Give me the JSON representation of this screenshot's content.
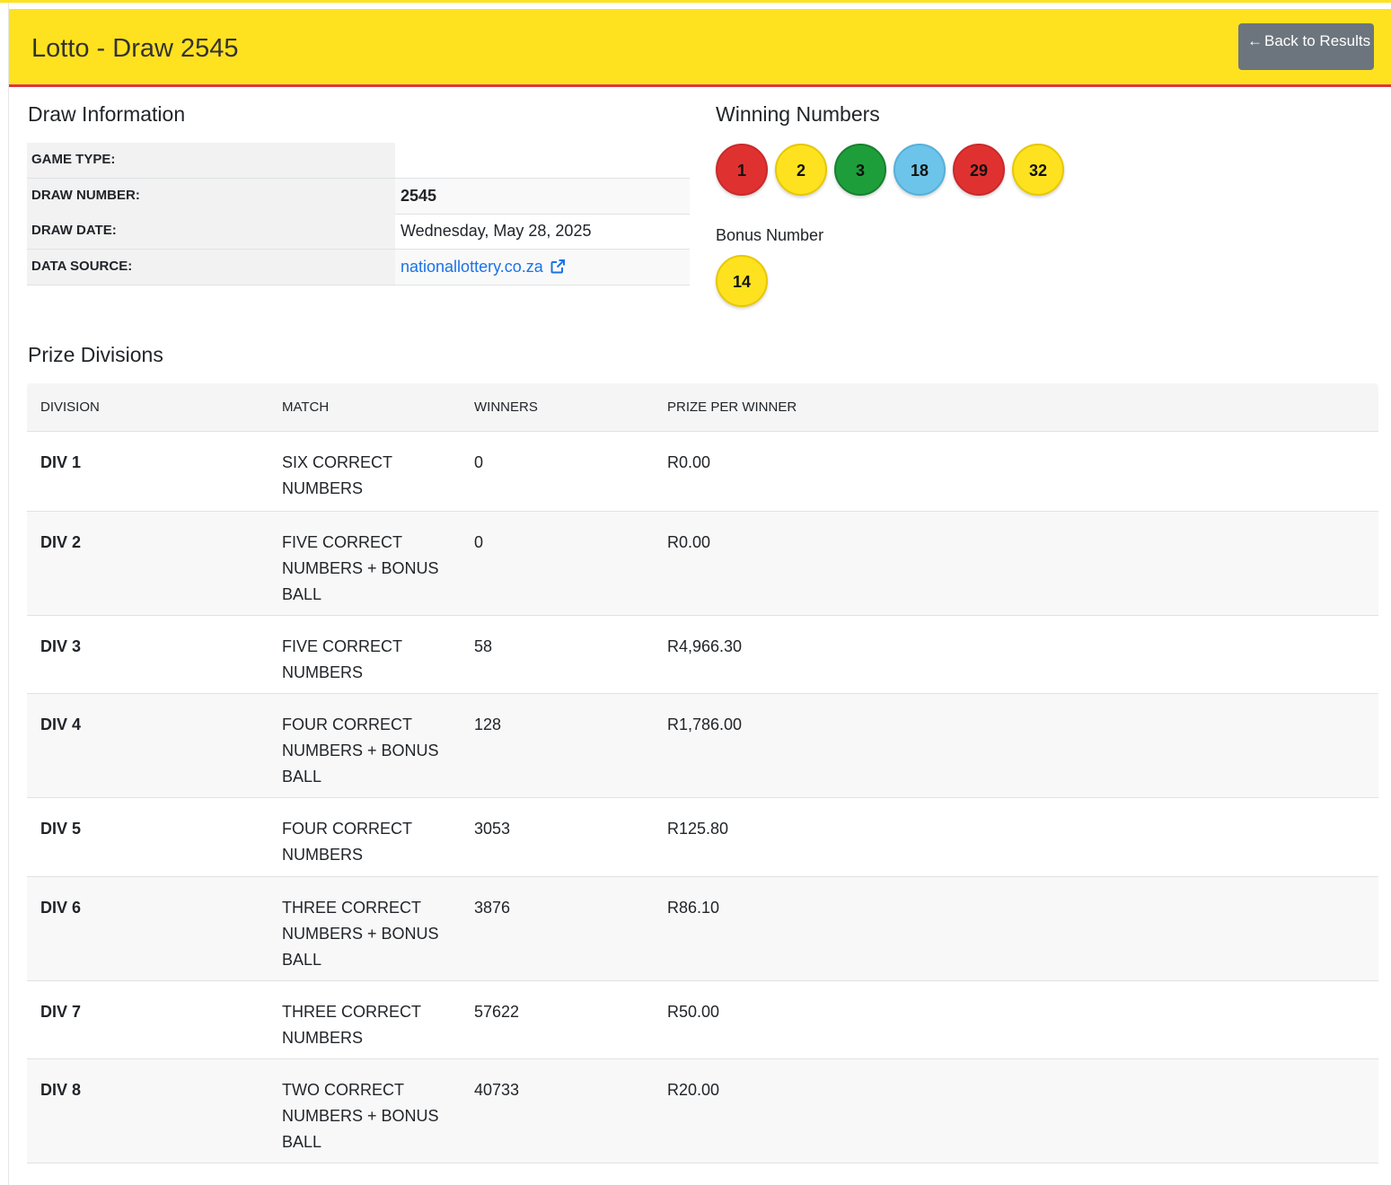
{
  "header": {
    "title": "Lotto - Draw 2545",
    "back_button_label": "Back to Results"
  },
  "draw_info": {
    "heading": "Draw Information",
    "rows": [
      {
        "label": "GAME TYPE:",
        "value": ""
      },
      {
        "label": "DRAW NUMBER:",
        "value": "2545"
      },
      {
        "label": "DRAW DATE:",
        "value": "Wednesday, May 28, 2025"
      },
      {
        "label": "DATA SOURCE:",
        "value": "nationallottery.co.za"
      }
    ]
  },
  "winning_numbers": {
    "heading": "Winning Numbers",
    "balls": [
      {
        "number": "1",
        "color": "#e03131"
      },
      {
        "number": "2",
        "color": "#ffe21f"
      },
      {
        "number": "3",
        "color": "#1e9e3a"
      },
      {
        "number": "18",
        "color": "#6cc4ea"
      },
      {
        "number": "29",
        "color": "#e03131"
      },
      {
        "number": "32",
        "color": "#ffe21f"
      }
    ],
    "bonus_label": "Bonus Number",
    "bonus": {
      "number": "14",
      "color": "#ffe21f"
    }
  },
  "prize_divisions": {
    "heading": "Prize Divisions",
    "columns": [
      "DIVISION",
      "MATCH",
      "WINNERS",
      "PRIZE PER WINNER"
    ],
    "rows": [
      {
        "division": "DIV 1",
        "match": "SIX CORRECT NUMBERS",
        "winners": "0",
        "prize": "R0.00"
      },
      {
        "division": "DIV 2",
        "match": "FIVE CORRECT NUMBERS + BONUS BALL",
        "winners": "0",
        "prize": "R0.00"
      },
      {
        "division": "DIV 3",
        "match": "FIVE CORRECT NUMBERS",
        "winners": "58",
        "prize": "R4,966.30"
      },
      {
        "division": "DIV 4",
        "match": "FOUR CORRECT NUMBERS + BONUS BALL",
        "winners": "128",
        "prize": "R1,786.00"
      },
      {
        "division": "DIV 5",
        "match": "FOUR CORRECT NUMBERS",
        "winners": "3053",
        "prize": "R125.80"
      },
      {
        "division": "DIV 6",
        "match": "THREE CORRECT NUMBERS + BONUS BALL",
        "winners": "3876",
        "prize": "R86.10"
      },
      {
        "division": "DIV 7",
        "match": "THREE CORRECT NUMBERS",
        "winners": "57622",
        "prize": "R50.00"
      },
      {
        "division": "DIV 8",
        "match": "TWO CORRECT NUMBERS + BONUS BALL",
        "winners": "40733",
        "prize": "R20.00"
      }
    ]
  },
  "colors": {
    "header_bg": "#ffe21f",
    "header_border": "#dc3545",
    "button_bg": "#6c757d",
    "link": "#1a73e8"
  }
}
